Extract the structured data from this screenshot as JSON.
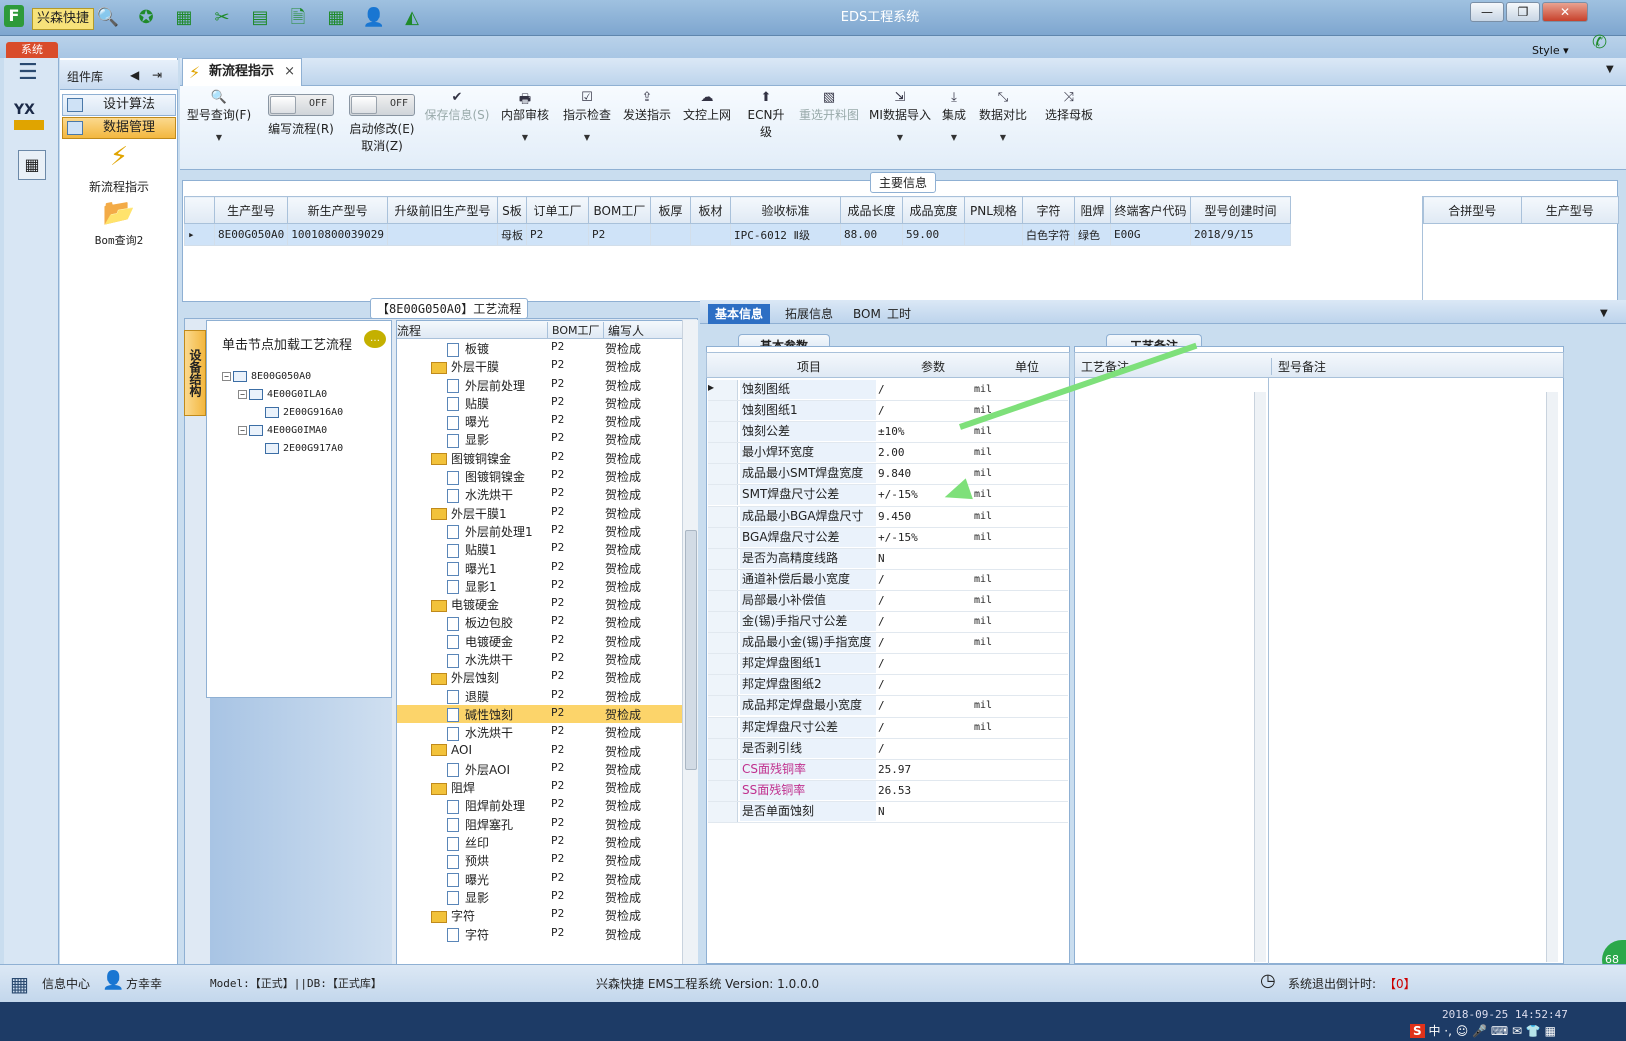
{
  "titlebar": {
    "brand": "兴森快捷",
    "system_title": "EDS工程系统",
    "app_logo": "F"
  },
  "menu": {
    "tab": "系统",
    "style_label": "Style"
  },
  "quick_icons": [
    "search-icon",
    "gear-icon",
    "grid-icon",
    "scissors-icon",
    "film-icon",
    "document-icon",
    "table-icon",
    "user-icon",
    "chart-icon"
  ],
  "window_buttons": {
    "min": "—",
    "restore": "❐",
    "close": "✕"
  },
  "leftnav": {
    "hamburger": "☰",
    "yx_label": "YX",
    "calc_icon": "▦"
  },
  "component_library": {
    "title": "组件库",
    "items": [
      {
        "label": "设计算法",
        "active": false
      },
      {
        "label": "数据管理",
        "active": true
      }
    ],
    "big_items": [
      {
        "label": "新流程指示",
        "icon": "⚡"
      },
      {
        "label": "Bom查询2",
        "icon": "📂"
      }
    ]
  },
  "doc_tab": {
    "label": "新流程指示",
    "close": "×"
  },
  "ribbon": {
    "buttons": [
      {
        "label": "型号查询(F)",
        "icon": "🔍",
        "dropdown": true
      },
      {
        "label": "编写流程(R)",
        "toggle": "OFF"
      },
      {
        "label": "启动修改(E)",
        "label2": "取消(Z)",
        "toggle": "OFF"
      },
      {
        "label": "保存信息(S)",
        "icon": "✔",
        "disabled": true
      },
      {
        "label": "内部审核",
        "icon": "🖶",
        "dropdown": true
      },
      {
        "label": "指示检查",
        "icon": "☑",
        "dropdown": true
      },
      {
        "label": "发送指示",
        "icon": "⇪"
      },
      {
        "label": "文控上网",
        "icon": "☁"
      },
      {
        "label": "ECN升级",
        "icon": "⬆"
      },
      {
        "label": "重选开料图",
        "icon": "▧",
        "disabled": true
      },
      {
        "label": "MI数据导入",
        "icon": "⇲",
        "dropdown": true
      },
      {
        "label": "集成",
        "icon": "⤓",
        "dropdown": true
      },
      {
        "label": "数据对比",
        "icon": "⤡",
        "dropdown": true
      },
      {
        "label": "选择母板",
        "icon": "⤨"
      }
    ]
  },
  "main_info": {
    "title": "主要信息",
    "columns": [
      "生产型号",
      "新生产型号",
      "升级前旧生产型号",
      "S板",
      "订单工厂",
      "BOM工厂",
      "板厚",
      "板材",
      "验收标准",
      "成品长度",
      "成品宽度",
      "PNL规格",
      "字符",
      "阻焊",
      "终端客户代码",
      "型号创建时间"
    ],
    "rows": [
      [
        "8E00G050A0",
        "10010800039029",
        "",
        "母板",
        "P2",
        "P2",
        "",
        "",
        "IPC-6012 Ⅱ级",
        "88.00",
        "59.00",
        "",
        "白色字符",
        "绿色",
        "E00G",
        "2018/9/15"
      ]
    ],
    "side_columns": [
      "合拼型号",
      "生产型号"
    ]
  },
  "process": {
    "title": "【8E00G050A0】工艺流程",
    "vertical_tab": "设备结构",
    "tree_hint": "单击节点加载工艺流程",
    "tree": [
      {
        "label": "8E00G050A0",
        "level": 0,
        "expand": "−"
      },
      {
        "label": "4E00G0ILA0",
        "level": 1,
        "expand": "−"
      },
      {
        "label": "2E00G916A0",
        "level": 2,
        "expand": ""
      },
      {
        "label": "4E00G0IMA0",
        "level": 1,
        "expand": "−"
      },
      {
        "label": "2E00G917A0",
        "level": 2,
        "expand": ""
      }
    ],
    "list_columns": [
      "流程",
      "BOM工厂",
      "编写人"
    ],
    "rows": [
      {
        "name": "板镀",
        "folder": false,
        "bom": "P2",
        "writer": "贺检成"
      },
      {
        "name": "外层干膜",
        "folder": true,
        "bom": "P2",
        "writer": "贺检成"
      },
      {
        "name": "外层前处理",
        "folder": false,
        "bom": "P2",
        "writer": "贺检成"
      },
      {
        "name": "贴膜",
        "folder": false,
        "bom": "P2",
        "writer": "贺检成"
      },
      {
        "name": "曝光",
        "folder": false,
        "bom": "P2",
        "writer": "贺检成"
      },
      {
        "name": "显影",
        "folder": false,
        "bom": "P2",
        "writer": "贺检成"
      },
      {
        "name": "图镀铜镍金",
        "folder": true,
        "bom": "P2",
        "writer": "贺检成"
      },
      {
        "name": "图镀铜镍金",
        "folder": false,
        "bom": "P2",
        "writer": "贺检成"
      },
      {
        "name": "水洗烘干",
        "folder": false,
        "bom": "P2",
        "writer": "贺检成"
      },
      {
        "name": "外层干膜1",
        "folder": true,
        "bom": "P2",
        "writer": "贺检成"
      },
      {
        "name": "外层前处理1",
        "folder": false,
        "bom": "P2",
        "writer": "贺检成"
      },
      {
        "name": "贴膜1",
        "folder": false,
        "bom": "P2",
        "writer": "贺检成"
      },
      {
        "name": "曝光1",
        "folder": false,
        "bom": "P2",
        "writer": "贺检成"
      },
      {
        "name": "显影1",
        "folder": false,
        "bom": "P2",
        "writer": "贺检成"
      },
      {
        "name": "电镀硬金",
        "folder": true,
        "bom": "P2",
        "writer": "贺检成"
      },
      {
        "name": "板边包胶",
        "folder": false,
        "bom": "P2",
        "writer": "贺检成"
      },
      {
        "name": "电镀硬金",
        "folder": false,
        "bom": "P2",
        "writer": "贺检成"
      },
      {
        "name": "水洗烘干",
        "folder": false,
        "bom": "P2",
        "writer": "贺检成"
      },
      {
        "name": "外层蚀刻",
        "folder": true,
        "bom": "P2",
        "writer": "贺检成"
      },
      {
        "name": "退膜",
        "folder": false,
        "bom": "P2",
        "writer": "贺检成"
      },
      {
        "name": "碱性蚀刻",
        "folder": false,
        "bom": "P2",
        "writer": "贺检成",
        "selected": true
      },
      {
        "name": "水洗烘干",
        "folder": false,
        "bom": "P2",
        "writer": "贺检成"
      },
      {
        "name": "AOI",
        "folder": true,
        "bom": "P2",
        "writer": "贺检成"
      },
      {
        "name": "外层AOI",
        "folder": false,
        "bom": "P2",
        "writer": "贺检成"
      },
      {
        "name": "阻焊",
        "folder": true,
        "bom": "P2",
        "writer": "贺检成"
      },
      {
        "name": "阻焊前处理",
        "folder": false,
        "bom": "P2",
        "writer": "贺检成"
      },
      {
        "name": "阻焊塞孔",
        "folder": false,
        "bom": "P2",
        "writer": "贺检成"
      },
      {
        "name": "丝印",
        "folder": false,
        "bom": "P2",
        "writer": "贺检成"
      },
      {
        "name": "预烘",
        "folder": false,
        "bom": "P2",
        "writer": "贺检成"
      },
      {
        "name": "曝光",
        "folder": false,
        "bom": "P2",
        "writer": "贺检成"
      },
      {
        "name": "显影",
        "folder": false,
        "bom": "P2",
        "writer": "贺检成"
      },
      {
        "name": "字符",
        "folder": true,
        "bom": "P2",
        "writer": "贺检成"
      },
      {
        "name": "字符",
        "folder": false,
        "bom": "P2",
        "writer": "贺检成"
      }
    ]
  },
  "right_tabs": [
    {
      "label": "基本信息",
      "active": true
    },
    {
      "label": "拓展信息",
      "active": false
    },
    {
      "label": "BOM",
      "active": false
    },
    {
      "label": "工时",
      "active": false
    }
  ],
  "params": {
    "subtab": "基本参数",
    "columns": [
      "项目",
      "参数",
      "单位"
    ],
    "rows": [
      {
        "item": "蚀刻图纸",
        "value": "/",
        "unit": "mil"
      },
      {
        "item": "蚀刻图纸1",
        "value": "/",
        "unit": "mil"
      },
      {
        "item": "蚀刻公差",
        "value": "±10%",
        "unit": "mil"
      },
      {
        "item": "最小焊环宽度",
        "value": "2.00",
        "unit": "mil"
      },
      {
        "item": "成品最小SMT焊盘宽度",
        "value": "9.840",
        "unit": "mil"
      },
      {
        "item": "SMT焊盘尺寸公差",
        "value": "+/-15%",
        "unit": "mil"
      },
      {
        "item": "成品最小BGA焊盘尺寸",
        "value": "9.450",
        "unit": "mil"
      },
      {
        "item": "BGA焊盘尺寸公差",
        "value": "+/-15%",
        "unit": "mil"
      },
      {
        "item": "是否为高精度线路",
        "value": "N",
        "unit": ""
      },
      {
        "item": "通道补偿后最小宽度",
        "value": "/",
        "unit": "mil"
      },
      {
        "item": "局部最小补偿值",
        "value": "/",
        "unit": "mil"
      },
      {
        "item": "金(锡)手指尺寸公差",
        "value": "/",
        "unit": "mil"
      },
      {
        "item": "成品最小金(锡)手指宽度",
        "value": "/",
        "unit": "mil"
      },
      {
        "item": "邦定焊盘图纸1",
        "value": "/",
        "unit": ""
      },
      {
        "item": "邦定焊盘图纸2",
        "value": "/",
        "unit": ""
      },
      {
        "item": "成品邦定焊盘最小宽度",
        "value": "/",
        "unit": "mil"
      },
      {
        "item": "邦定焊盘尺寸公差",
        "value": "/",
        "unit": "mil"
      },
      {
        "item": "是否剥引线",
        "value": "/",
        "unit": ""
      },
      {
        "item": "CS面残铜率",
        "value": "25.97",
        "unit": "",
        "highlight": true
      },
      {
        "item": "SS面残铜率",
        "value": "26.53",
        "unit": "",
        "highlight": true
      },
      {
        "item": "是否单面蚀刻",
        "value": "N",
        "unit": ""
      }
    ]
  },
  "notes": {
    "subtab": "工艺备注",
    "columns": [
      "工艺备注",
      "型号备注"
    ]
  },
  "status": {
    "info_center": "信息中心",
    "user": "方幸幸",
    "model_db": "Model:【正式】||DB:【正式库】",
    "version": "兴森快捷 EMS工程系统 Version: 1.0.0.0",
    "countdown_label": "系统退出倒计时:",
    "countdown_value": "【0】",
    "datetime": "2018-09-25 14:52:47"
  },
  "badge": "68",
  "ime": "中 ·, ☺ 🎤 ⌨ ✉ 👕 ▦",
  "colors": {
    "accent": "#2d6fc4",
    "highlight": "#fcd46a",
    "arrow": "#7ee07a"
  }
}
